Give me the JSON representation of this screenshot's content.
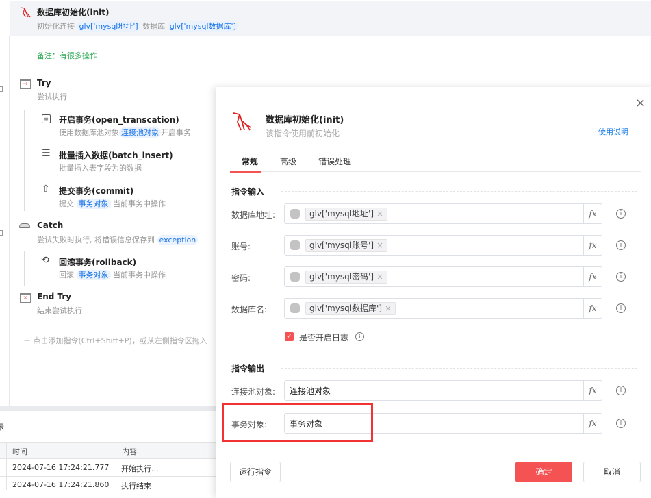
{
  "flow": {
    "header": {
      "title": "数据库初始化(init)",
      "desc_prefix": "初始化连接",
      "chip1": "glv['mysql地址']",
      "desc_mid": "数据库",
      "chip2": "glv['mysql数据库']"
    },
    "note": "备注：有很多操作",
    "try": {
      "title": "Try",
      "desc": "尝试执行"
    },
    "open": {
      "title": "开启事务(open_transcation)",
      "desc_prefix": "使用数据库池对象",
      "chip": "连接池对象",
      "desc_suffix": "开启事务"
    },
    "batch": {
      "title": "批量插入数据(batch_insert)",
      "desc": "批量插入表字段为的数据"
    },
    "commit": {
      "title": "提交事务(commit)",
      "desc_prefix": "提交",
      "chip": "事务对象",
      "desc_suffix": "当前事务中操作"
    },
    "catch": {
      "title": "Catch",
      "desc_prefix": "尝试失败时执行, 将错误信息保存到",
      "chip": "exception"
    },
    "rollback": {
      "title": "回滚事务(rollback)",
      "desc_prefix": "回滚",
      "chip": "事务对象",
      "desc_suffix": "当前事务中操作"
    },
    "endtry": {
      "title": "End Try",
      "desc": "结束尝试执行"
    },
    "add_hint": "点击添加指令(Ctrl+Shift+P)，或从左侧指令区拖入"
  },
  "log": {
    "tab_label": "示",
    "columns": [
      "时间",
      "内容"
    ],
    "rows": [
      [
        "2024-07-16 17:24:21.777",
        "开始执行..."
      ],
      [
        "2024-07-16 17:24:21.860",
        "执行结束"
      ]
    ]
  },
  "dialog": {
    "title": "数据库初始化(init)",
    "subtitle": "该指令使用前初始化",
    "help_link": "使用说明",
    "tabs": [
      "常规",
      "高级",
      "错误处理"
    ],
    "input_section": "指令输入",
    "inputs": [
      {
        "label": "数据库地址:",
        "tag": "glv['mysql地址']"
      },
      {
        "label": "账号:",
        "tag": "glv['mysql账号']"
      },
      {
        "label": "密码:",
        "tag": "glv['mysql密码']"
      },
      {
        "label": "数据库名:",
        "tag": "glv['mysql数据库']"
      }
    ],
    "log_checkbox": {
      "label": "是否开启日志",
      "checked": true
    },
    "output_section": "指令输出",
    "outputs": [
      {
        "label": "连接池对象:",
        "value": "连接池对象"
      },
      {
        "label": "事务对象:",
        "value": "事务对象"
      }
    ],
    "fx": "fx",
    "info": "i",
    "close": "×",
    "remove": "×",
    "buttons": {
      "run": "运行指令",
      "ok": "确定",
      "cancel": "取消"
    },
    "accent": "#f55353",
    "highlight": "#f33333"
  }
}
